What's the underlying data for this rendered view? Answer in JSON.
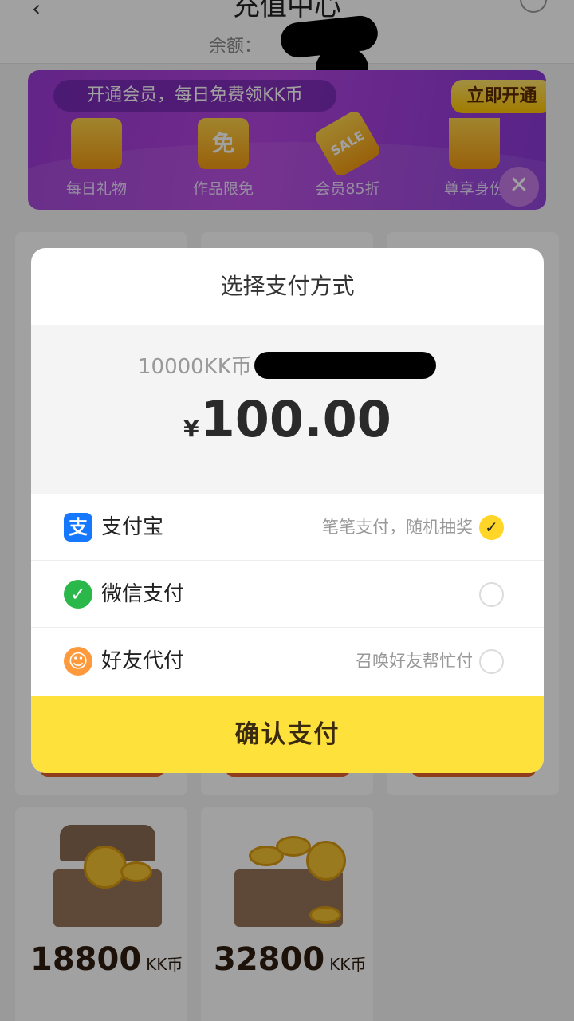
{
  "header": {
    "title": "充值中心",
    "balance_label": "余额："
  },
  "vip_banner": {
    "promo": "开通会员，每日免费领KK币",
    "open_button": "立即开通",
    "perks": [
      {
        "icon": "gift-icon",
        "glyph": "",
        "label": "每日礼物"
      },
      {
        "icon": "free-tag-icon",
        "glyph": "免",
        "label": "作品限免"
      },
      {
        "icon": "sale-tag-icon",
        "glyph": "SALE",
        "label": "会员85折"
      },
      {
        "icon": "crown-icon",
        "glyph": "",
        "label": "尊享身份"
      }
    ],
    "close_glyph": "✕"
  },
  "packages": [
    {
      "amount": "18800",
      "unit": "KK币"
    },
    {
      "amount": "32800",
      "unit": "KK币"
    }
  ],
  "payment_modal": {
    "title": "选择支付方式",
    "product": "10000KK币",
    "currency_symbol": "¥",
    "price": "100.00",
    "methods": [
      {
        "icon": "alipay-icon",
        "glyph": "支",
        "name": "支付宝",
        "hint": "笔笔支付，随机抽奖",
        "selected": true
      },
      {
        "icon": "wechat-icon",
        "glyph": "✓",
        "name": "微信支付",
        "hint": "",
        "selected": false
      },
      {
        "icon": "friend-pay-icon",
        "glyph": "☺",
        "name": "好友代付",
        "hint": "召唤好友帮忙付",
        "selected": false
      }
    ],
    "confirm_label": "确认支付",
    "check_glyph": "✓"
  },
  "colors": {
    "accent_yellow": "#ffe13b",
    "alipay_blue": "#1677ff",
    "wechat_green": "#2bb84a",
    "friend_orange": "#ff9a3c",
    "vip_purple": "#a13fdc"
  }
}
